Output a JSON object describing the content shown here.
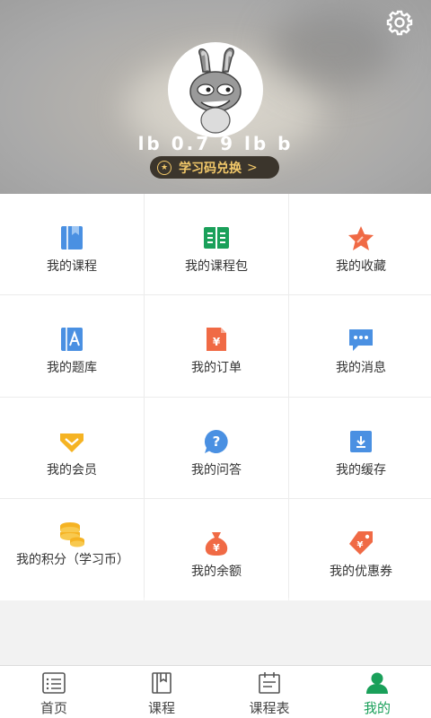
{
  "header": {
    "username": "lb 0.7 9 lb b",
    "redeem_label": "学习码兑换",
    "redeem_arrow": ">"
  },
  "menu": [
    {
      "label": "我的课程",
      "icon": "course-icon",
      "color": "#4a90e2"
    },
    {
      "label": "我的课程包",
      "icon": "course-package-icon",
      "color": "#1aa05a"
    },
    {
      "label": "我的收藏",
      "icon": "favorite-star-icon",
      "color": "#f06a45"
    },
    {
      "label": "我的题库",
      "icon": "question-bank-icon",
      "color": "#4a90e2"
    },
    {
      "label": "我的订单",
      "icon": "order-icon",
      "color": "#f06a45"
    },
    {
      "label": "我的消息",
      "icon": "message-icon",
      "color": "#4a90e2"
    },
    {
      "label": "我的会员",
      "icon": "membership-icon",
      "color": "#f5b323"
    },
    {
      "label": "我的问答",
      "icon": "qa-icon",
      "color": "#4a90e2"
    },
    {
      "label": "我的缓存",
      "icon": "download-cache-icon",
      "color": "#4a90e2"
    },
    {
      "label": "我的积分（学习币）",
      "icon": "points-coins-icon",
      "color": "#f5b323"
    },
    {
      "label": "我的余额",
      "icon": "balance-bag-icon",
      "color": "#f06a45"
    },
    {
      "label": "我的优惠券",
      "icon": "coupon-icon",
      "color": "#f06a45"
    }
  ],
  "tabs": [
    {
      "label": "首页",
      "icon": "home-list-icon"
    },
    {
      "label": "课程",
      "icon": "course-book-icon"
    },
    {
      "label": "课程表",
      "icon": "schedule-icon"
    },
    {
      "label": "我的",
      "icon": "profile-icon",
      "active": true
    }
  ],
  "colors": {
    "accent": "#1aa05a",
    "redeem_text": "#f3c96a",
    "redeem_bg": "#3b352c"
  }
}
